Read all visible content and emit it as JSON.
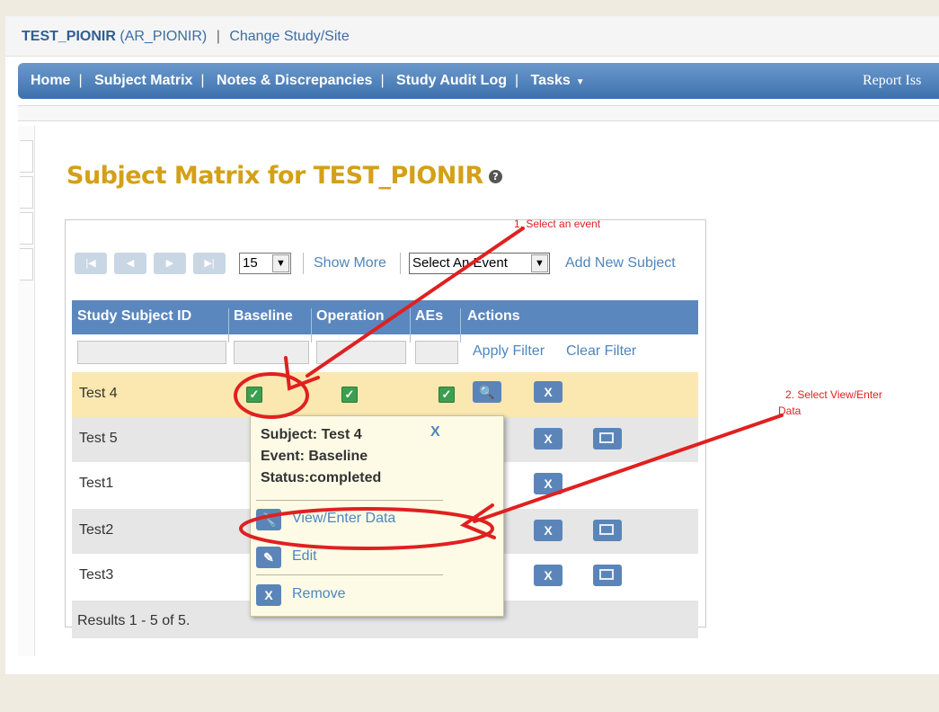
{
  "top": {
    "study_code": "TEST_PIONIR",
    "study_paren": "(AR_PIONIR)",
    "separator": "|",
    "change_link": "Change Study/Site"
  },
  "nav": {
    "items": [
      "Home",
      "Subject Matrix",
      "Notes & Discrepancies",
      "Study Audit Log",
      "Tasks"
    ],
    "report": "Report Iss"
  },
  "page": {
    "title": "Subject Matrix for TEST_PIONIR",
    "help_icon": "?"
  },
  "toolbar": {
    "page_size": "15",
    "show_more": "Show More",
    "event_select": "Select An Event",
    "add_subject": "Add New Subject"
  },
  "table": {
    "headers": [
      "Study Subject ID",
      "Baseline",
      "Operation",
      "AEs",
      "Actions"
    ],
    "apply_filter": "Apply Filter",
    "clear_filter": "Clear Filter",
    "rows": [
      {
        "id": "Test 4"
      },
      {
        "id": "Test 5"
      },
      {
        "id": "Test1"
      },
      {
        "id": "Test2"
      },
      {
        "id": "Test3"
      }
    ],
    "results": "Results 1 - 5 of 5."
  },
  "popup": {
    "subject": "Subject: Test 4",
    "event": "Event: Baseline",
    "status": "Status:completed",
    "close": "X",
    "view": "View/Enter Data",
    "edit": "Edit",
    "remove": "Remove"
  },
  "annotations": {
    "note1": "1. Select an event",
    "note2_line1": "2. Select View/Enter",
    "note2_line2": "Data",
    "arrow_color": "#e02020"
  },
  "colors": {
    "title": "#d4a017",
    "nav": "#4a7bb5",
    "highlight_row": "#fbe8b0",
    "alt_row": "#e6e6e6"
  }
}
